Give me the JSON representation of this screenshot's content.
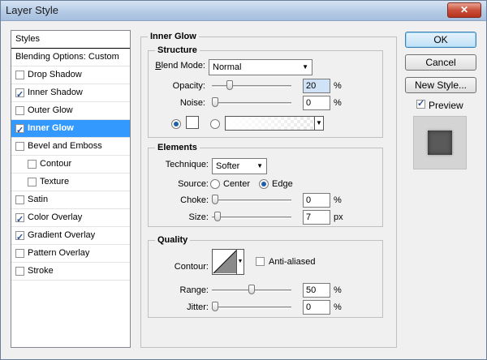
{
  "window": {
    "title": "Layer Style",
    "close_glyph": "✕"
  },
  "styles_list": {
    "header": "Styles",
    "blending": "Blending Options: Custom",
    "items": [
      {
        "label": "Drop Shadow",
        "checked": false,
        "indent": false
      },
      {
        "label": "Inner Shadow",
        "checked": true,
        "indent": false
      },
      {
        "label": "Outer Glow",
        "checked": false,
        "indent": false
      },
      {
        "label": "Inner Glow",
        "checked": true,
        "indent": false,
        "selected": true
      },
      {
        "label": "Bevel and Emboss",
        "checked": false,
        "indent": false
      },
      {
        "label": "Contour",
        "checked": false,
        "indent": true
      },
      {
        "label": "Texture",
        "checked": false,
        "indent": true
      },
      {
        "label": "Satin",
        "checked": false,
        "indent": false
      },
      {
        "label": "Color Overlay",
        "checked": true,
        "indent": false
      },
      {
        "label": "Gradient Overlay",
        "checked": true,
        "indent": false
      },
      {
        "label": "Pattern Overlay",
        "checked": false,
        "indent": false
      },
      {
        "label": "Stroke",
        "checked": false,
        "indent": false
      }
    ]
  },
  "panel": {
    "title": "Inner Glow",
    "structure": {
      "title": "Structure",
      "blend_mode_label": "Blend Mode:",
      "blend_mode_value": "Normal",
      "opacity_label": "Opacity:",
      "opacity_value": "20",
      "opacity_fraction": 0.2,
      "noise_label": "Noise:",
      "noise_value": "0",
      "noise_fraction": 0,
      "unit": "%"
    },
    "elements": {
      "title": "Elements",
      "technique_label": "Technique:",
      "technique_value": "Softer",
      "source_label": "Source:",
      "source_center": "Center",
      "source_edge": "Edge",
      "choke_label": "Choke:",
      "choke_value": "0",
      "choke_fraction": 0,
      "size_label": "Size:",
      "size_value": "7",
      "size_fraction": 0.03,
      "pct_unit": "%",
      "px_unit": "px"
    },
    "quality": {
      "title": "Quality",
      "contour_label": "Contour:",
      "anti_aliased_label": "Anti-aliased",
      "anti_aliased_checked": false,
      "range_label": "Range:",
      "range_value": "50",
      "range_fraction": 0.5,
      "jitter_label": "Jitter:",
      "jitter_value": "0",
      "jitter_fraction": 0,
      "unit": "%"
    }
  },
  "buttons": {
    "ok": "OK",
    "cancel": "Cancel",
    "new_style": "New Style...",
    "preview_label": "Preview",
    "preview_checked": true
  },
  "colors": {
    "selection": "#3399ff",
    "accent": "#1f5fa8"
  }
}
